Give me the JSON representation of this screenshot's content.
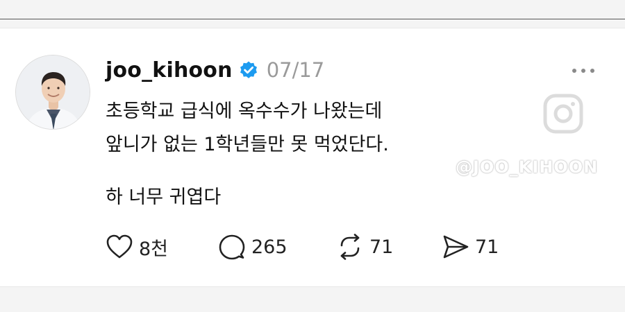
{
  "post": {
    "username": "joo_kihoon",
    "date": "07/17",
    "body_lines": [
      "초등학교 급식에 옥수수가 나왔는데",
      "앞니가 없는 1학년들만 못 먹었단다.",
      "하 너무 귀엽다"
    ],
    "watermark": "@JOO_KIHOON",
    "actions": {
      "likes": "8천",
      "comments": "265",
      "reposts": "71",
      "shares": "71"
    }
  },
  "icons": {
    "verified": "verified-badge-icon",
    "more": "more-dots-icon",
    "like": "heart-icon",
    "comment": "comment-bubble-icon",
    "repost": "repost-icon",
    "share": "send-icon",
    "watermark_logo": "instagram-icon"
  },
  "colors": {
    "verified": "#1d9bf0",
    "date": "#9a9a9a"
  }
}
